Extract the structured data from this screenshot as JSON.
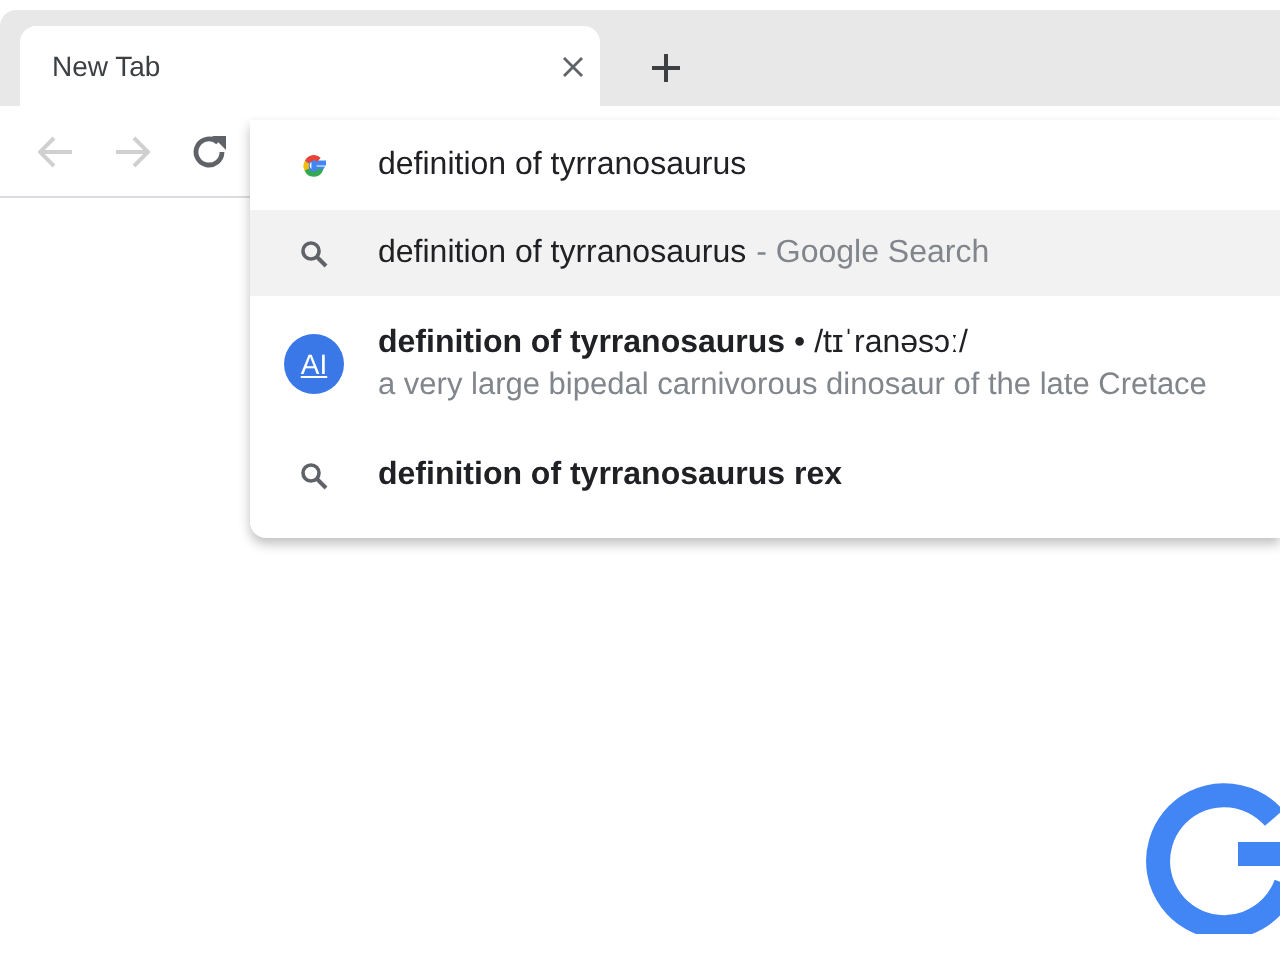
{
  "tabs": [
    {
      "title": "New Tab",
      "selected": true
    }
  ],
  "toolbar": {
    "back_disabled": true,
    "forward_disabled": true
  },
  "omnibox": {
    "value": "definition of tyrranosaurus"
  },
  "suggestions": [
    {
      "kind": "search",
      "text": "definition of tyrranosaurus",
      "suffix": "- Google Search",
      "emphasized": false,
      "selected": true
    },
    {
      "kind": "answer",
      "badge": "AI",
      "title": "**definition of tyrranosaurus** • /tɪˈranəsɔː/",
      "description": "a very large bipedal carnivorous dinosaur of the late Cretace",
      "selected": false
    },
    {
      "kind": "search",
      "text": "definition of tyrranosaurus rex",
      "emphasized": true,
      "selected": false
    }
  ]
}
